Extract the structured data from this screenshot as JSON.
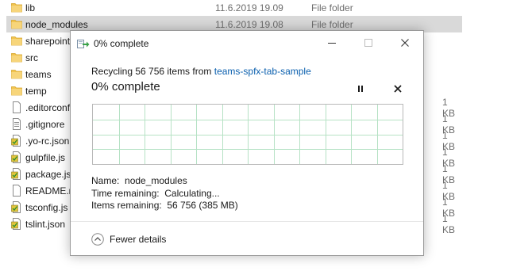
{
  "explorer": {
    "rows": [
      {
        "name": "lib",
        "date": "11.6.2019 19.09",
        "type": "File folder",
        "size": "",
        "icon": "folder-icon",
        "selected": false
      },
      {
        "name": "node_modules",
        "date": "11.6.2019 19.08",
        "type": "File folder",
        "size": "",
        "icon": "folder-icon",
        "selected": true
      },
      {
        "name": "sharepoint",
        "date": "",
        "type": "",
        "size": "",
        "icon": "folder-icon",
        "selected": false
      },
      {
        "name": "src",
        "date": "",
        "type": "",
        "size": "",
        "icon": "folder-icon",
        "selected": false
      },
      {
        "name": "teams",
        "date": "",
        "type": "",
        "size": "",
        "icon": "folder-icon",
        "selected": false
      },
      {
        "name": "temp",
        "date": "",
        "type": "",
        "size": "",
        "icon": "folder-icon",
        "selected": false
      },
      {
        "name": ".editorconf",
        "date": "",
        "type": "",
        "size": "1 KB",
        "icon": "file-icon",
        "selected": false
      },
      {
        "name": ".gitignore",
        "date": "",
        "type": "",
        "size": "1 KB",
        "icon": "text-file-icon",
        "selected": false
      },
      {
        "name": ".yo-rc.json",
        "date": "",
        "type": "",
        "size": "1 KB",
        "icon": "script-file-icon",
        "selected": false
      },
      {
        "name": "gulpfile.js",
        "date": "",
        "type": "",
        "size": "1 KB",
        "icon": "script-file-icon",
        "selected": false
      },
      {
        "name": "package.js",
        "date": "",
        "type": "",
        "size": "1 KB",
        "icon": "script-file-icon",
        "selected": false
      },
      {
        "name": "README.m",
        "date": "",
        "type": "",
        "size": "1 KB",
        "icon": "file-icon",
        "selected": false
      },
      {
        "name": "tsconfig.js",
        "date": "",
        "type": "",
        "size": "1 KB",
        "icon": "script-file-icon",
        "selected": false
      },
      {
        "name": "tslint.json",
        "date": "",
        "type": "",
        "size": "1 KB",
        "icon": "script-file-icon",
        "selected": false
      }
    ]
  },
  "dialog": {
    "title": "0% complete",
    "title_icon": "recycle-progress-icon",
    "window_buttons": {
      "minimize": "minimize-icon",
      "maximize": "maximize-icon",
      "close": "close-icon"
    },
    "recycling_prefix": "Recycling 56 756 items from ",
    "recycling_source": "teams-spfx-tab-sample",
    "percent_text": "0% complete",
    "progress_fraction": 0,
    "pause_icon": "pause-icon",
    "cancel_icon": "close-icon",
    "details": {
      "name_label": "Name:",
      "name_value": "node_modules",
      "time_label": "Time remaining:",
      "time_value": "Calculating...",
      "items_label": "Items remaining:",
      "items_value": "56 756 (385 MB)"
    },
    "fewer_details_label": "Fewer details",
    "fewer_details_icon": "chevron-up-circle-icon"
  },
  "colors": {
    "selection": "#d9d9d9",
    "folder": "#f2c44e",
    "link": "#0a5fae",
    "graph_grid": "#b6e2c5"
  }
}
